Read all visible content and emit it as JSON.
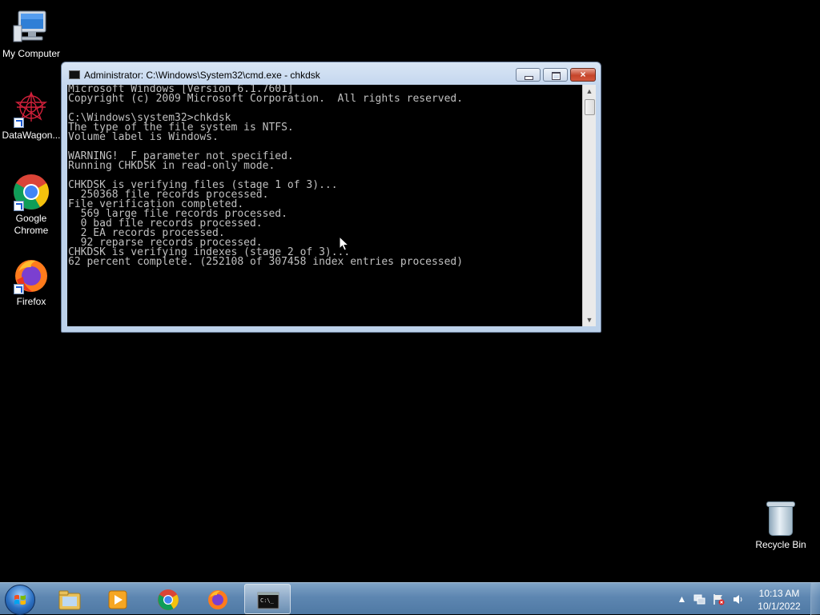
{
  "desktop": {
    "icons": [
      {
        "label": "My Computer",
        "icon": "computer-icon"
      },
      {
        "label": "DataWagon...",
        "icon": "datawagon-icon"
      },
      {
        "label": "Google Chrome",
        "icon": "chrome-icon"
      },
      {
        "label": "Firefox",
        "icon": "firefox-icon"
      }
    ],
    "recycle_bin": {
      "label": "Recycle Bin",
      "icon": "recycle-bin-icon"
    }
  },
  "window": {
    "title": "Administrator: C:\\Windows\\System32\\cmd.exe - chkdsk",
    "controls": {
      "minimize": "minimize-icon",
      "maximize": "maximize-icon",
      "close": "×"
    },
    "console_lines": [
      "Microsoft Windows [Version 6.1.7601]",
      "Copyright (c) 2009 Microsoft Corporation.  All rights reserved.",
      "",
      "C:\\Windows\\system32>chkdsk",
      "The type of the file system is NTFS.",
      "Volume label is Windows.",
      "",
      "WARNING!  F parameter not specified.",
      "Running CHKDSK in read-only mode.",
      "",
      "CHKDSK is verifying files (stage 1 of 3)...",
      "  250368 file records processed.",
      "File verification completed.",
      "  569 large file records processed.",
      "  0 bad file records processed.",
      "  2 EA records processed.",
      "  92 reparse records processed.",
      "CHKDSK is verifying indexes (stage 2 of 3)...",
      "62 percent complete. (252108 of 307458 index entries processed)"
    ]
  },
  "taskbar": {
    "start": "start-orb-icon",
    "pinned": [
      "explorer-icon",
      "media-player-icon",
      "chrome-icon",
      "firefox-icon",
      "cmd-icon"
    ],
    "tray_icons": [
      "show-hidden-icons",
      "network-icon",
      "action-center-icon",
      "volume-icon"
    ],
    "clock": {
      "time": "10:13 AM",
      "date": "10/1/2022"
    }
  },
  "colors": {
    "console_text": "#c0c0c0",
    "console_bg": "#000000",
    "desktop_bg": "#000000",
    "taskbar": "#5d86b1"
  }
}
